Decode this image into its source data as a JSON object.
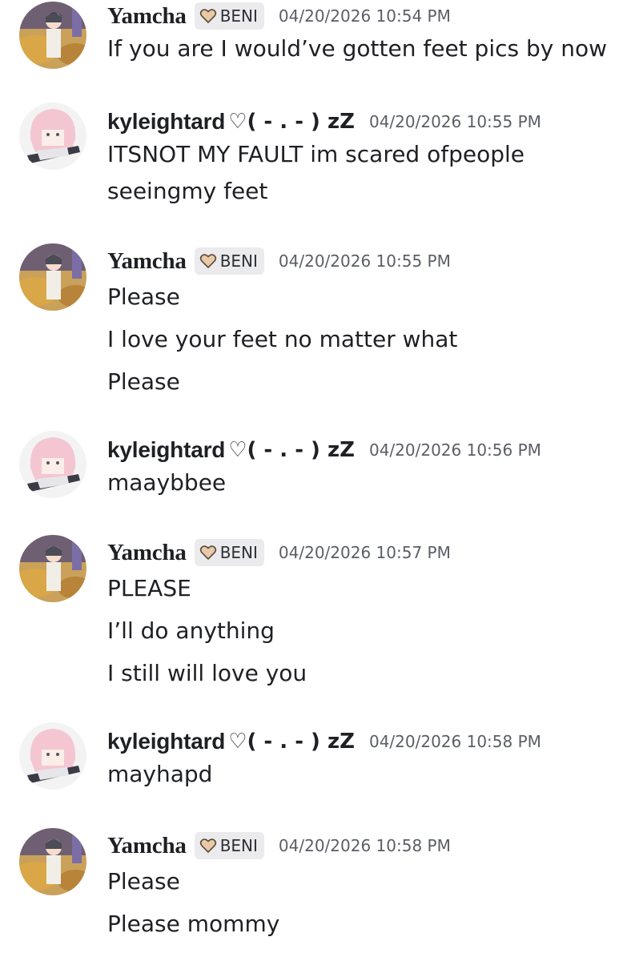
{
  "messages": [
    {
      "author": "Yamcha",
      "tag": "BENI",
      "timestamp": "04/20/2026 10:54 PM",
      "lines": [
        "If you are I would’ve gotten feet pics by now"
      ]
    },
    {
      "author": "kyleightard",
      "author_decoration": "♡( - . - ) zZ",
      "timestamp": "04/20/2026 10:55 PM",
      "lines": [
        "ITSNOT MY FAULT im scared ofpeople",
        "seeingmy feet"
      ]
    },
    {
      "author": "Yamcha",
      "tag": "BENI",
      "timestamp": "04/20/2026 10:55 PM",
      "lines": [
        "Please",
        "I love your feet no matter what",
        "Please"
      ]
    },
    {
      "author": "kyleightard",
      "author_decoration": "♡( - . - ) zZ",
      "timestamp": "04/20/2026 10:56 PM",
      "lines": [
        "maaybbee"
      ]
    },
    {
      "author": "Yamcha",
      "tag": "BENI",
      "timestamp": "04/20/2026 10:57 PM",
      "lines": [
        "PLEASE",
        "I’ll do anything",
        "I still will love you"
      ]
    },
    {
      "author": "kyleightard",
      "author_decoration": "♡( - . - ) zZ",
      "timestamp": "04/20/2026 10:58 PM",
      "lines": [
        "mayhapd"
      ]
    },
    {
      "author": "Yamcha",
      "tag": "BENI",
      "timestamp": "04/20/2026 10:58 PM",
      "lines": [
        "Please",
        "Please mommy"
      ]
    }
  ],
  "colors": {
    "background": "#ffffff",
    "text": "#1f2024",
    "timestamp": "#5c5e66",
    "tag_background": "#ebebed"
  },
  "icons": {
    "tag_icon": "heart-badge-icon",
    "yamcha_avatar": "dark-haired-character-avatar",
    "kyleightard_avatar": "pink-haired-character-avatar"
  }
}
